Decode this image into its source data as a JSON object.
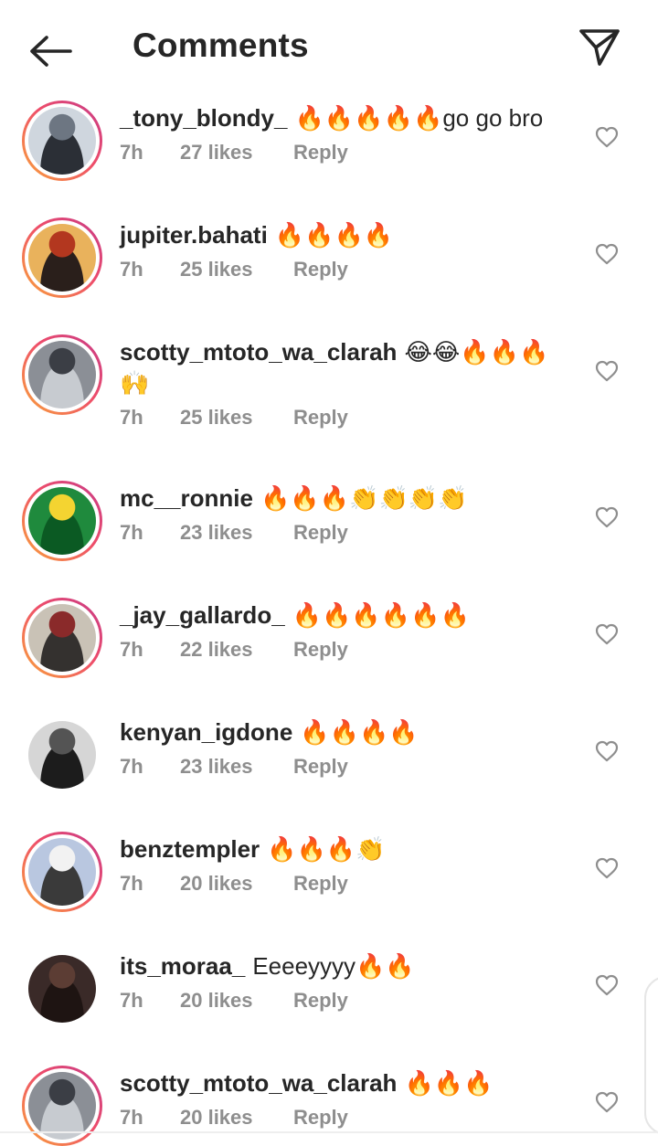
{
  "header": {
    "title": "Comments",
    "back_icon": "arrow-left-icon",
    "share_icon": "paper-plane-icon"
  },
  "comments": [
    {
      "user": "_tony_blondy_",
      "text": "🔥🔥🔥🔥🔥go go bro",
      "time": "7h",
      "likes": "27 likes",
      "reply": "Reply",
      "story": true
    },
    {
      "user": "jupiter.bahati",
      "text": "🔥🔥🔥🔥",
      "time": "7h",
      "likes": "25 likes",
      "reply": "Reply",
      "story": true
    },
    {
      "user": "scotty_mtoto_wa_clarah",
      "text": "😂😂🔥🔥🔥🙌",
      "time": "7h",
      "likes": "25 likes",
      "reply": "Reply",
      "story": true
    },
    {
      "user": "mc__ronnie",
      "text": "🔥🔥🔥👏👏👏👏",
      "time": "7h",
      "likes": "23 likes",
      "reply": "Reply",
      "story": true
    },
    {
      "user": "_jay_gallardo_",
      "text": "🔥🔥🔥🔥🔥🔥",
      "time": "7h",
      "likes": "22 likes",
      "reply": "Reply",
      "story": true
    },
    {
      "user": "kenyan_igdone",
      "text": "🔥🔥🔥🔥",
      "time": "7h",
      "likes": "23 likes",
      "reply": "Reply",
      "story": false
    },
    {
      "user": "benztempler",
      "text": "🔥🔥🔥👏",
      "time": "7h",
      "likes": "20 likes",
      "reply": "Reply",
      "story": true
    },
    {
      "user": "its_moraa_",
      "text": "Eeeeyyyy🔥🔥",
      "time": "7h",
      "likes": "20 likes",
      "reply": "Reply",
      "story": false
    },
    {
      "user": "scotty_mtoto_wa_clarah",
      "text": "🔥🔥🔥",
      "time": "7h",
      "likes": "20 likes",
      "reply": "Reply",
      "story": true
    }
  ],
  "colors": {
    "text": "#262626",
    "meta": "#8e8e8e",
    "story_ring_start": "#f9a43a",
    "story_ring_end": "#c63a88"
  }
}
